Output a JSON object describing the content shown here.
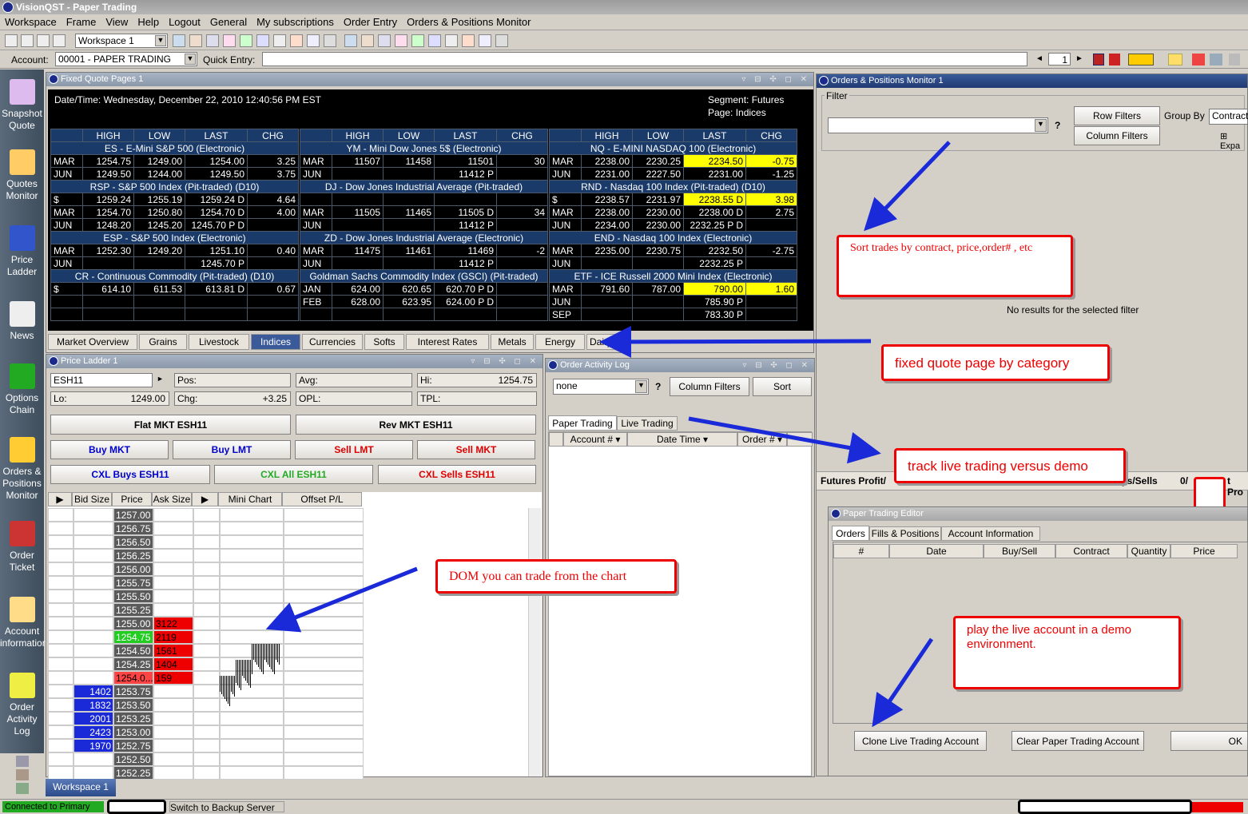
{
  "window": {
    "title": "VisionQST - Paper Trading"
  },
  "menu": [
    "Workspace",
    "Frame",
    "View",
    "Help",
    "Logout",
    "General",
    "My subscriptions",
    "Order Entry",
    "Orders & Positions Monitor"
  ],
  "toolbar": {
    "workspace_select": "Workspace 1"
  },
  "account_bar": {
    "account_label": "Account:",
    "account_value": "00001 - PAPER TRADING",
    "quick_entry_label": "Quick Entry:",
    "page_num": "1"
  },
  "sidebar": [
    {
      "label": "Snapshot Quote",
      "icon": "snapshot-quote-icon"
    },
    {
      "label": "Quotes Monitor",
      "icon": "quotes-monitor-icon"
    },
    {
      "label": "Price Ladder",
      "icon": "price-ladder-icon"
    },
    {
      "label": "News",
      "icon": "news-icon"
    },
    {
      "label": "Options Chain",
      "icon": "options-chain-icon"
    },
    {
      "label": "Orders & Positions Monitor",
      "icon": "orders-positions-icon"
    },
    {
      "label": "Order Ticket",
      "icon": "order-ticket-icon"
    },
    {
      "label": "Account information",
      "icon": "account-information-icon"
    },
    {
      "label": "Order Activity Log",
      "icon": "order-activity-log-icon"
    }
  ],
  "quote_panel": {
    "title": "Fixed Quote Pages 1",
    "datetime": "Date/Time: Wednesday, December 22, 2010 12:40:56 PM EST",
    "segment": "Segment: Futures",
    "page": "Page: Indices",
    "headers": [
      "HIGH",
      "LOW",
      "LAST",
      "CHG"
    ],
    "columns": [
      [
        {
          "title": "ES - E-Mini S&P 500 (Electronic)",
          "rows": [
            [
              "MAR",
              "1254.75",
              "1249.00",
              "1254.00",
              "3.25",
              "up"
            ],
            [
              "JUN",
              "1249.50",
              "1244.00",
              "1249.50",
              "3.75",
              "up"
            ]
          ]
        },
        {
          "title": "RSP - S&P 500 Index (Pit-traded) (D10)",
          "rows": [
            [
              "$",
              "1259.24",
              "1255.19",
              "1259.24 D",
              "4.64",
              "up"
            ],
            [
              "MAR",
              "1254.70",
              "1250.80",
              "1254.70 D",
              "4.00",
              "up"
            ],
            [
              "JUN",
              "1248.20",
              "1245.20",
              "1245.70 P D",
              "",
              ""
            ]
          ]
        },
        {
          "title": "ESP - S&P 500 Index (Electronic)",
          "rows": [
            [
              "MAR",
              "1252.30",
              "1249.20",
              "1251.10",
              "0.40",
              "up"
            ],
            [
              "JUN",
              "",
              "",
              "1245.70 P",
              "",
              ""
            ]
          ]
        },
        {
          "title": "CR - Continuous Commodity (Pit-traded) (D10)",
          "rows": [
            [
              "$",
              "614.10",
              "611.53",
              "613.81 D",
              "0.67",
              "up"
            ],
            [
              "",
              "",
              "",
              "",
              "",
              ""
            ],
            [
              "",
              "",
              "",
              "",
              "",
              ""
            ]
          ]
        }
      ],
      [
        {
          "title": "YM - Mini Dow Jones 5$ (Electronic)",
          "rows": [
            [
              "MAR",
              "11507",
              "11458",
              "11501",
              "30",
              "up"
            ],
            [
              "JUN",
              "",
              "",
              "11412 P",
              "",
              ""
            ]
          ]
        },
        {
          "title": "DJ - Dow Jones Industrial Average (Pit-traded)",
          "rows": [
            [
              "",
              "",
              "",
              "",
              "",
              ""
            ],
            [
              "MAR",
              "11505",
              "11465",
              "11505 D",
              "34",
              "up"
            ],
            [
              "JUN",
              "",
              "",
              "11412 P",
              "",
              ""
            ]
          ]
        },
        {
          "title": "ZD - Dow Jones Industrial Average (Electronic)",
          "rows": [
            [
              "MAR",
              "11475",
              "11461",
              "11469",
              "-2",
              "dn"
            ],
            [
              "JUN",
              "",
              "",
              "11412 P",
              "",
              ""
            ]
          ]
        },
        {
          "title": "Goldman Sachs Commodity Index (GSCI) (Pit-traded)",
          "rows": [
            [
              "JAN",
              "624.00",
              "620.65",
              "620.70 P D",
              "",
              ""
            ],
            [
              "FEB",
              "628.00",
              "623.95",
              "624.00 P D",
              "",
              ""
            ],
            [
              "",
              "",
              "",
              "",
              "",
              ""
            ]
          ]
        }
      ],
      [
        {
          "title": "NQ - E-MINI NASDAQ 100 (Electronic)",
          "rows": [
            [
              "MAR",
              "2238.00",
              "2230.25",
              "2234.50",
              "-0.75",
              "dn hl"
            ],
            [
              "JUN",
              "2231.00",
              "2227.50",
              "2231.00",
              "-1.25",
              "dn"
            ]
          ]
        },
        {
          "title": "RND - Nasdaq 100 Index (Pit-traded) (D10)",
          "rows": [
            [
              "$",
              "2238.57",
              "2231.97",
              "2238.55 D",
              "3.98",
              "up hl"
            ],
            [
              "MAR",
              "2238.00",
              "2230.00",
              "2238.00 D",
              "2.75",
              "up"
            ],
            [
              "JUN",
              "2234.00",
              "2230.00",
              "2232.25 P D",
              "",
              ""
            ]
          ]
        },
        {
          "title": "END - Nasdaq 100 Index (Electronic)",
          "rows": [
            [
              "MAR",
              "2235.00",
              "2230.75",
              "2232.50",
              "-2.75",
              "dn"
            ],
            [
              "JUN",
              "",
              "",
              "2232.25 P",
              "",
              ""
            ]
          ]
        },
        {
          "title": "ETF - ICE Russell 2000 Mini Index (Electronic)",
          "rows": [
            [
              "MAR",
              "791.60",
              "787.00",
              "790.00",
              "1.60",
              "up hl"
            ],
            [
              "JUN",
              "",
              "",
              "785.90 P",
              "",
              ""
            ],
            [
              "SEP",
              "",
              "",
              "783.30 P",
              "",
              ""
            ]
          ]
        }
      ]
    ],
    "tabs": [
      "Market Overview",
      "Grains",
      "Livestock",
      "Indices",
      "Currencies",
      "Softs",
      "Interest Rates",
      "Metals",
      "Energy",
      "Dairy"
    ],
    "active_tab": "Indices"
  },
  "price_ladder": {
    "title": "Price Ladder 1",
    "symbol": "ESH11",
    "pos_label": "Pos:",
    "avg_label": "Avg:",
    "hi_label": "Hi:",
    "hi_value": "1254.75",
    "lo_label": "Lo:",
    "lo_value": "1249.00",
    "chg_label": "Chg:",
    "chg_value": "+3.25",
    "opl_label": "OPL:",
    "tpl_label": "TPL:",
    "flat_btn": "Flat MKT ESH11",
    "rev_btn": "Rev MKT ESH11",
    "buy_mkt": "Buy MKT",
    "buy_lmt": "Buy LMT",
    "sell_lmt": "Sell LMT",
    "sell_mkt": "Sell MKT",
    "cxl_buys": "CXL Buys ESH11",
    "cxl_all": "CXL All ESH11",
    "cxl_sells": "CXL Sells ESH11",
    "columns": [
      "Bid Size",
      "Price",
      "Ask Size",
      "Mini Chart",
      "Offset P/L"
    ],
    "rows": [
      [
        "",
        "1257.00",
        ""
      ],
      [
        "",
        "1256.75",
        ""
      ],
      [
        "",
        "1256.50",
        ""
      ],
      [
        "",
        "1256.25",
        ""
      ],
      [
        "",
        "1256.00",
        ""
      ],
      [
        "",
        "1255.75",
        ""
      ],
      [
        "",
        "1255.50",
        ""
      ],
      [
        "",
        "1255.25",
        ""
      ],
      [
        "",
        "1255.00",
        "3122"
      ],
      [
        "",
        "1254.75",
        "2119"
      ],
      [
        "",
        "1254.50",
        "1561"
      ],
      [
        "",
        "1254.25",
        "1404"
      ],
      [
        "",
        "1254.0...",
        "159"
      ],
      [
        "1402",
        "1253.75",
        ""
      ],
      [
        "1832",
        "1253.50",
        ""
      ],
      [
        "2001",
        "1253.25",
        ""
      ],
      [
        "2423",
        "1253.00",
        ""
      ],
      [
        "1970",
        "1252.75",
        ""
      ],
      [
        "",
        "1252.50",
        ""
      ],
      [
        "",
        "1252.25",
        ""
      ]
    ]
  },
  "order_log": {
    "title": "Order Activity Log",
    "filter": "none",
    "column_filters": "Column Filters",
    "sort": "Sort",
    "tabs": [
      "Paper Trading",
      "Live Trading"
    ],
    "columns": [
      "Account #",
      "Date Time",
      "Order #"
    ]
  },
  "orders_monitor": {
    "title": "Orders & Positions Monitor 1",
    "filter_label": "Filter",
    "row_filters": "Row Filters",
    "column_filters": "Column Filters",
    "group_by": "Group By",
    "group_value": "Contract",
    "expand": "Expa",
    "no_results": "No results for the selected filter",
    "futures_profit": "Futures Profit/",
    "buys_sells": "ys/Sells",
    "count": "0/",
    "t_pro": "t Pro"
  },
  "paper_editor": {
    "title": "Paper Trading Editor",
    "tabs": [
      "Orders",
      "Fills & Positions",
      "Account Information"
    ],
    "columns": [
      "#",
      "Date",
      "Buy/Sell",
      "Contract",
      "Quantity",
      "Price"
    ],
    "clone": "Clone Live Trading Account",
    "clear": "Clear Paper Trading Account",
    "ok": "OK"
  },
  "callouts": {
    "sort": "Sort trades by contract, price,order# , etc",
    "fixed": "fixed quote page by category",
    "track": "track live trading versus demo",
    "dom": "DOM you can trade from the chart",
    "play": "play the live account in a demo environment."
  },
  "bottom": {
    "workspace_tab": "Workspace 1",
    "status_connected": "Connected to Primary",
    "backup": "Switch to Backup Server"
  }
}
